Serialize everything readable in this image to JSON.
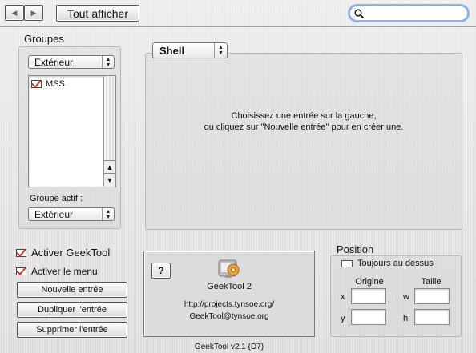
{
  "toolbar": {
    "show_all_label": "Tout afficher",
    "search_placeholder": ""
  },
  "groups": {
    "title": "Groupes",
    "selected": "Extérieur",
    "items": [
      {
        "label": "MSS",
        "checked": true
      }
    ],
    "active_group_label": "Groupe actif :",
    "active_group_selected": "Extérieur"
  },
  "entry_type": {
    "selected": "Shell"
  },
  "editor": {
    "message_line1": "Choisissez une entrée sur la gauche,",
    "message_line2": "ou cliquez sur \"Nouvelle entrée\" pour en créer une."
  },
  "controls": {
    "activate_geektool": "Activer GeekTool",
    "activate_menu": "Activer le menu",
    "new_entry": "Nouvelle entrée",
    "duplicate_entry": "Dupliquer l'entrée",
    "delete_entry": "Supprimer l'entrée"
  },
  "about": {
    "help_label": "?",
    "app_name": "GeekTool 2",
    "url": "http://projects.tynsoe.org/",
    "email": "GeekTool@tynsoe.org"
  },
  "position": {
    "title": "Position",
    "always_on_top": "Toujours au dessus",
    "origin_label": "Origine",
    "size_label": "Taille",
    "x_label": "x",
    "y_label": "y",
    "w_label": "w",
    "h_label": "h"
  },
  "footer": {
    "version": "GeekTool v2.1 (D7)"
  },
  "colors": {
    "focus_ring": "#7aa7e0",
    "check_mark": "#c0392b"
  }
}
